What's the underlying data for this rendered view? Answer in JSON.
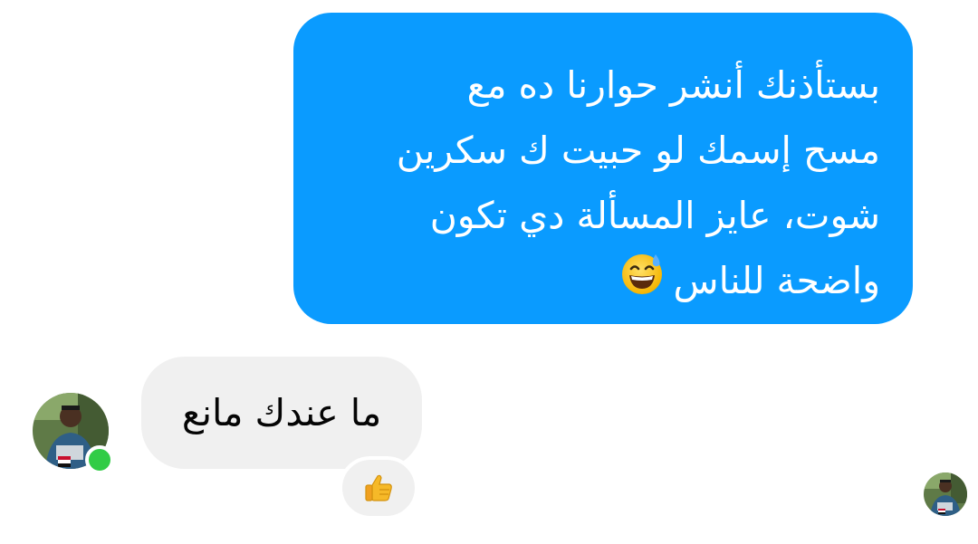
{
  "outgoing_message": {
    "lines": [
      "بستأذنك أنشر حوارنا ده مع",
      "مسح إسمك لو حبيت ك سكرين",
      "شوت، عايز المسألة دي تكون",
      "واضحة للناس"
    ],
    "emoji": "grinning-face-with-sweat-icon",
    "bubble_color": "#0a9bff",
    "text_color": "#ffffff"
  },
  "incoming_message": {
    "text": "ما عندك مانع",
    "bubble_color": "#f0f0f0",
    "text_color": "#050505"
  },
  "reaction": {
    "emoji": "thumbs-up-icon"
  },
  "contact": {
    "status": "online",
    "status_color": "#31cc46"
  }
}
